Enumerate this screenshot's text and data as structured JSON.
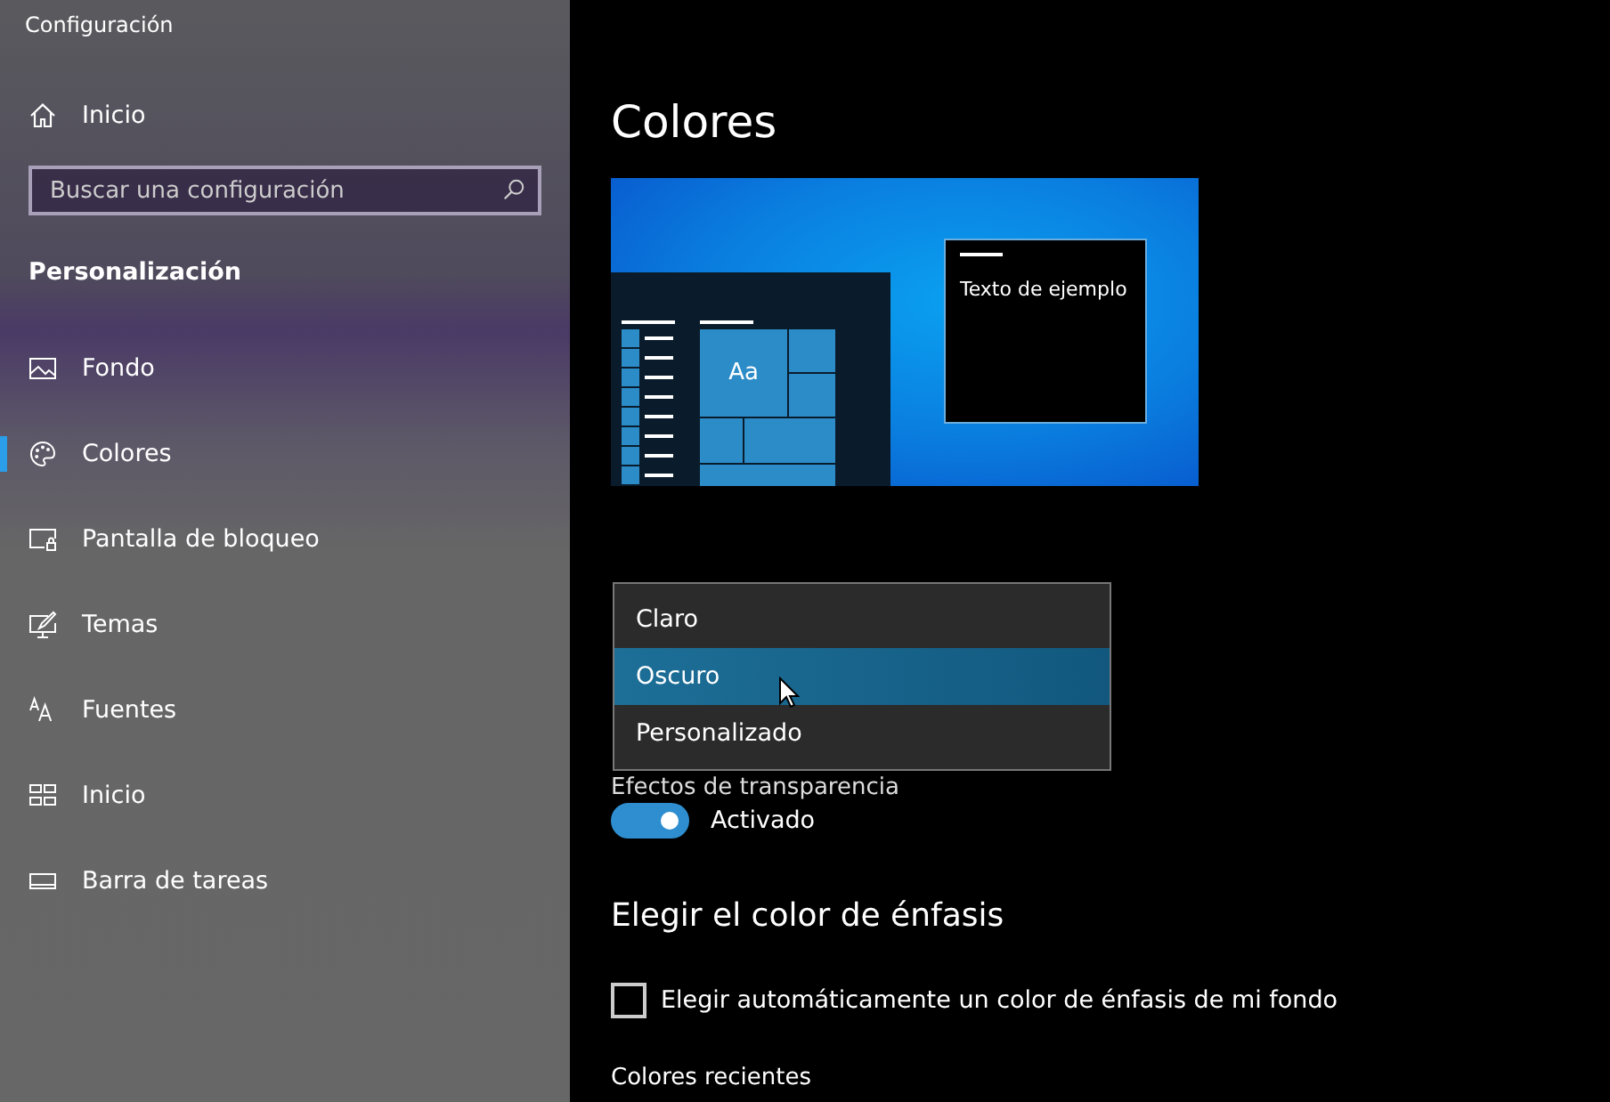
{
  "window": {
    "title": "Configuración"
  },
  "sidebar": {
    "home": {
      "label": "Inicio"
    },
    "search": {
      "placeholder": "Buscar una configuración"
    },
    "section": "Personalización",
    "items": [
      {
        "label": "Fondo",
        "selected": false
      },
      {
        "label": "Colores",
        "selected": true
      },
      {
        "label": "Pantalla de bloqueo",
        "selected": false
      },
      {
        "label": "Temas",
        "selected": false
      },
      {
        "label": "Fuentes",
        "selected": false
      },
      {
        "label": "Inicio",
        "selected": false
      },
      {
        "label": "Barra de tareas",
        "selected": false
      }
    ]
  },
  "main": {
    "title": "Colores",
    "preview": {
      "tile_text": "Aa",
      "sample_text": "Texto de ejemplo"
    },
    "dropdown": {
      "options": [
        {
          "label": "Claro",
          "selected": false
        },
        {
          "label": "Oscuro",
          "selected": true
        },
        {
          "label": "Personalizado",
          "selected": false
        }
      ]
    },
    "transparency": {
      "label": "Efectos de transparencia",
      "on": true,
      "state": "Activado"
    },
    "accent": {
      "title": "Elegir el color de énfasis",
      "auto": {
        "label": "Elegir automáticamente un color de énfasis de mi fondo",
        "checked": false
      },
      "recent": "Colores recientes"
    }
  }
}
